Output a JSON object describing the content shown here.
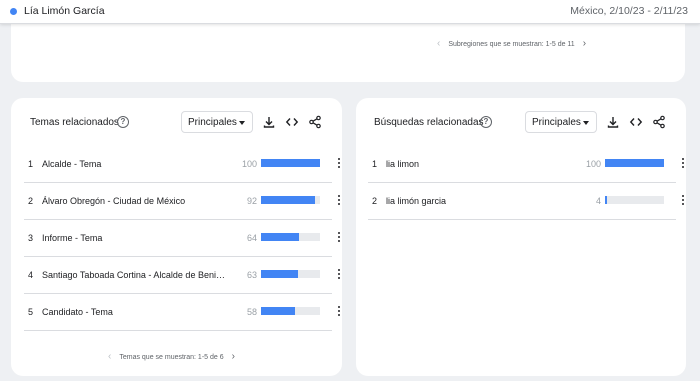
{
  "header": {
    "search_term": "Lía Limón García",
    "region_dates": "México, 2/10/23 - 2/11/23",
    "accent_color": "#4285f4"
  },
  "subregions": {
    "pager_text": "Subregiones que se muestran: 1-5 de 11"
  },
  "related_topics": {
    "title": "Temas relacionados",
    "select_value": "Principales",
    "pager_text": "Temas que se muestran: 1-5 de 6",
    "rows": [
      {
        "rank": "1",
        "label": "Alcalde - Tema",
        "value": "100",
        "fraction": 1.0
      },
      {
        "rank": "2",
        "label": "Álvaro Obregón - Ciudad de México",
        "value": "92",
        "fraction": 0.92
      },
      {
        "rank": "3",
        "label": "Informe - Tema",
        "value": "64",
        "fraction": 0.64
      },
      {
        "rank": "4",
        "label": "Santiago Taboada Cortina - Alcalde de Beni…",
        "value": "63",
        "fraction": 0.63
      },
      {
        "rank": "5",
        "label": "Candidato - Tema",
        "value": "58",
        "fraction": 0.58
      }
    ]
  },
  "related_queries": {
    "title": "Búsquedas relacionadas",
    "select_value": "Principales",
    "rows": [
      {
        "rank": "1",
        "label": "lia limon",
        "value": "100",
        "fraction": 1.0
      },
      {
        "rank": "2",
        "label": "lia limón garcia",
        "value": "4",
        "fraction": 0.04
      }
    ]
  },
  "icons": {
    "help": "help-circle-icon",
    "download": "download-icon",
    "embed": "embed-code-icon",
    "share": "share-icon",
    "more": "more-vertical-icon",
    "prev": "chevron-left-icon",
    "next": "chevron-right-icon"
  }
}
